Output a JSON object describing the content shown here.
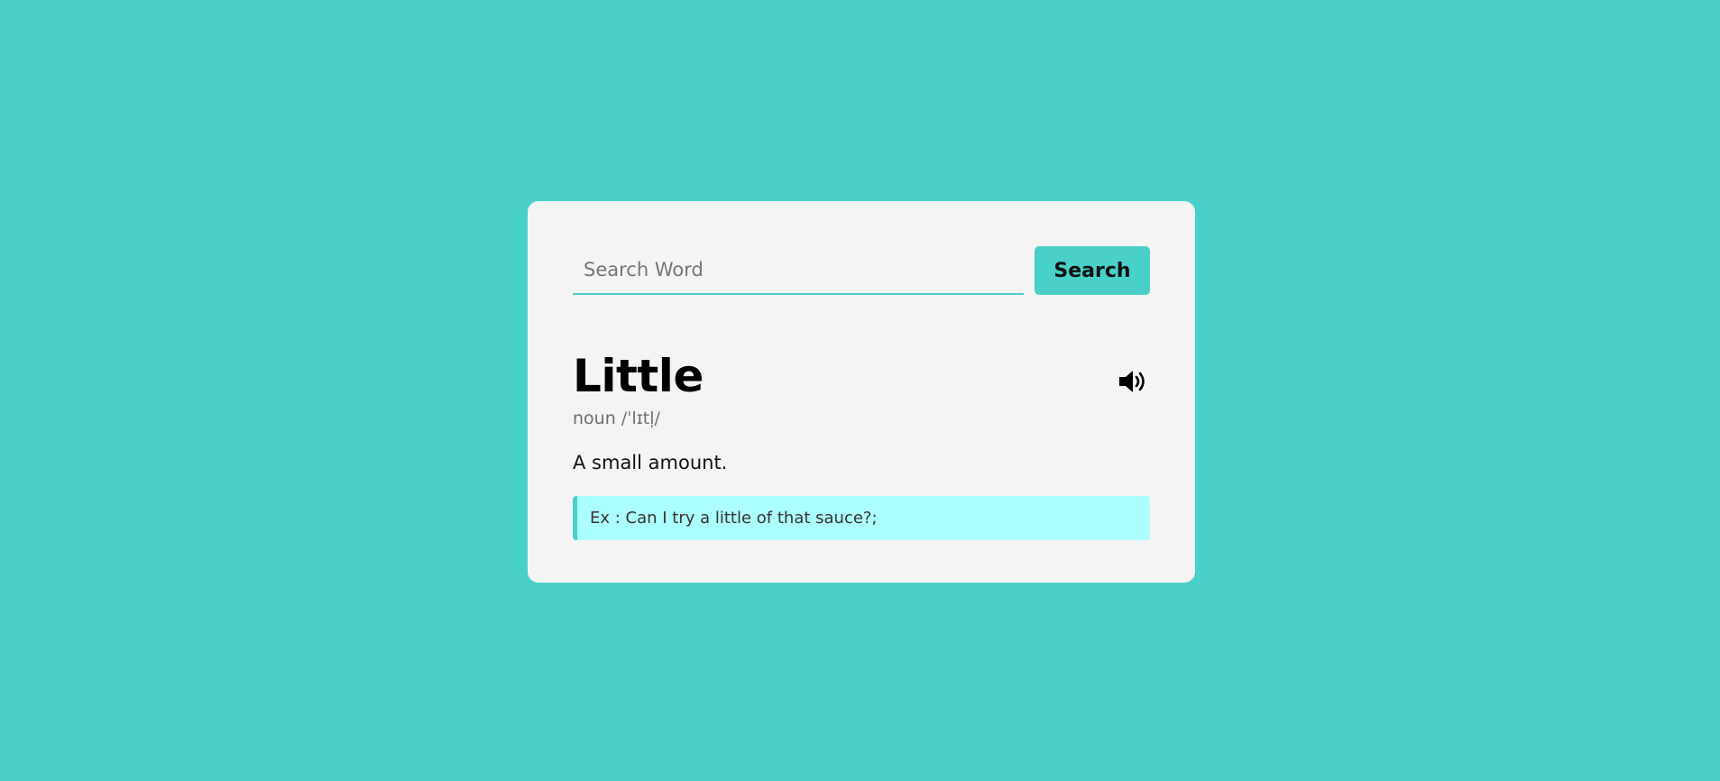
{
  "search": {
    "placeholder": "Search Word",
    "value": "",
    "button_label": "Search"
  },
  "result": {
    "word": "Little",
    "part_of_speech": "noun",
    "phonetic": "/ˈlɪtl̩/",
    "details": "noun /ˈlɪtl̩/",
    "meaning": "A small amount.",
    "example": "Ex : Can I try a little of that sauce?;"
  },
  "icons": {
    "sound": "volume-up-icon"
  },
  "colors": {
    "background": "#4ad0cb",
    "card": "#f4f4f4",
    "accent": "#4ad0cb",
    "example_background": "#abfffe"
  }
}
